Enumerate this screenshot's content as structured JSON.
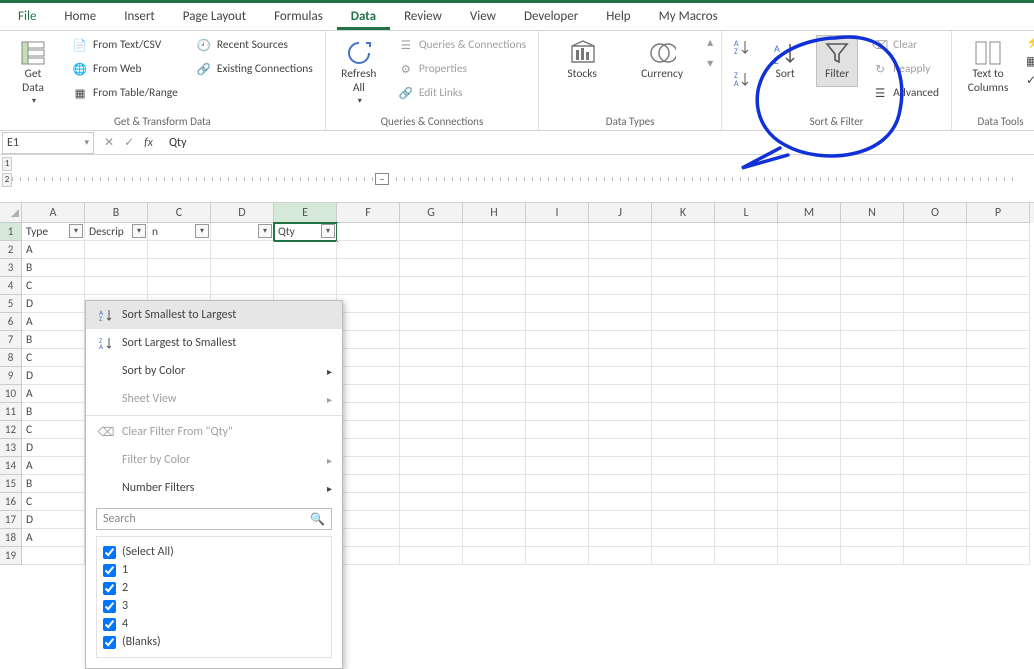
{
  "tabs": {
    "file": "File",
    "home": "Home",
    "insert": "Insert",
    "page_layout": "Page Layout",
    "formulas": "Formulas",
    "data": "Data",
    "review": "Review",
    "view": "View",
    "developer": "Developer",
    "help": "Help",
    "my_macros": "My Macros"
  },
  "ribbon": {
    "get_data": "Get\nData",
    "from_text_csv": "From Text/CSV",
    "from_web": "From Web",
    "from_table_range": "From Table/Range",
    "recent_sources": "Recent Sources",
    "existing_connections": "Existing Connections",
    "group_get_transform": "Get & Transform Data",
    "refresh_all": "Refresh\nAll",
    "queries_connections": "Queries & Connections",
    "properties": "Properties",
    "edit_links": "Edit Links",
    "group_queries": "Queries & Connections",
    "stocks": "Stocks",
    "currency": "Currency",
    "group_data_types": "Data Types",
    "sort": "Sort",
    "filter": "Filter",
    "clear": "Clear",
    "reapply": "Reapply",
    "advanced": "Advanced",
    "group_sort_filter": "Sort & Filter",
    "text_to_columns": "Text to\nColumns",
    "group_data_tools": "Data Tools"
  },
  "formula_bar": {
    "name_box": "E1",
    "formula": "Qty"
  },
  "columns": [
    "A",
    "B",
    "C",
    "D",
    "E",
    "F",
    "G",
    "H",
    "I",
    "J",
    "K",
    "L",
    "M",
    "N",
    "O",
    "P"
  ],
  "header_cells": {
    "A": "Type",
    "B": "Descrip",
    "C": "n",
    "E": "Qty"
  },
  "row_data": [
    "A",
    "B",
    "C",
    "D",
    "A",
    "B",
    "C",
    "D",
    "A",
    "B",
    "C",
    "D",
    "A",
    "B",
    "C",
    "D",
    "A"
  ],
  "filter_menu": {
    "sort_asc": "Sort Smallest to Largest",
    "sort_desc": "Sort Largest to Smallest",
    "sort_by_color": "Sort by Color",
    "sheet_view": "Sheet View",
    "clear_filter": "Clear Filter From \"Qty\"",
    "filter_by_color": "Filter by Color",
    "number_filters": "Number Filters",
    "search_placeholder": "Search",
    "checks": [
      "(Select All)",
      "1",
      "2",
      "3",
      "4",
      "(Blanks)"
    ]
  }
}
